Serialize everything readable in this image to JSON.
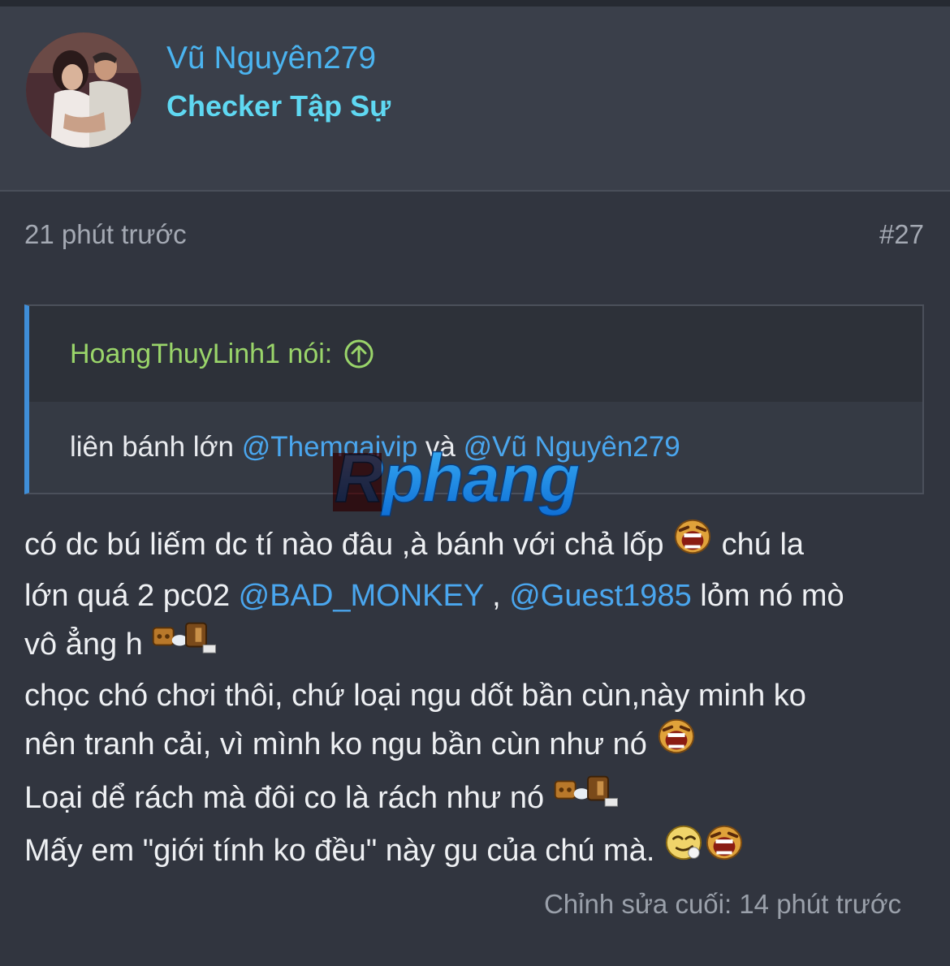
{
  "header": {
    "username": "Vũ Nguyên279",
    "user_title": "Checker Tập Sự"
  },
  "post_meta": {
    "time": "21 phút trước",
    "post_number": "#27"
  },
  "quote": {
    "author": "HoangThuyLinh1 nói:",
    "text_prefix": "liên bánh lớn ",
    "mention_1": "@Themgaivip",
    "text_mid": " và ",
    "mention_2": "@Vũ Nguyên279"
  },
  "watermark": {
    "text": "Rphang"
  },
  "post_body": {
    "line1": "có dc bú liếm dc tí nào đâu ,à bánh với chả lốp ",
    "line1_tail": " chú la",
    "line2_prefix": "lớn quá 2 pc02 ",
    "line2_mention_1": "@BAD_MONKEY",
    "line2_sep": " , ",
    "line2_mention_2": "@Guest1985",
    "line2_tail": " lỏm nó mò",
    "line3": "vô ẳng h ",
    "line4": "chọc chó chơi thôi, chứ loại ngu dốt bần cùn,này minh ko",
    "line5": "nên tranh cải, vì mình ko ngu bần cùn như nó ",
    "line6": "Loại dể rách mà đôi co là rách như nó ",
    "line7": "Mấy em \"giới tính ko đều\" này gu của chú mà. "
  },
  "footer": {
    "edit_note": "Chỉnh sửa cuối: 14 phút trước"
  },
  "icons": {
    "avatar": "user-avatar-photo",
    "quote_up": "arrow-up-circle-icon",
    "laugh": "laughing-emoji",
    "shoot": "gun-shooting-emoji",
    "sly": "sly-face-emoji"
  },
  "colors": {
    "background": "#31353f",
    "header_bg": "#3a3f4a",
    "username": "#4bb4f0",
    "user_title": "#5fd8f2",
    "quote_author": "#9ad56a",
    "mention": "#4aa6ee",
    "quote_border": "#3f8ed8"
  }
}
